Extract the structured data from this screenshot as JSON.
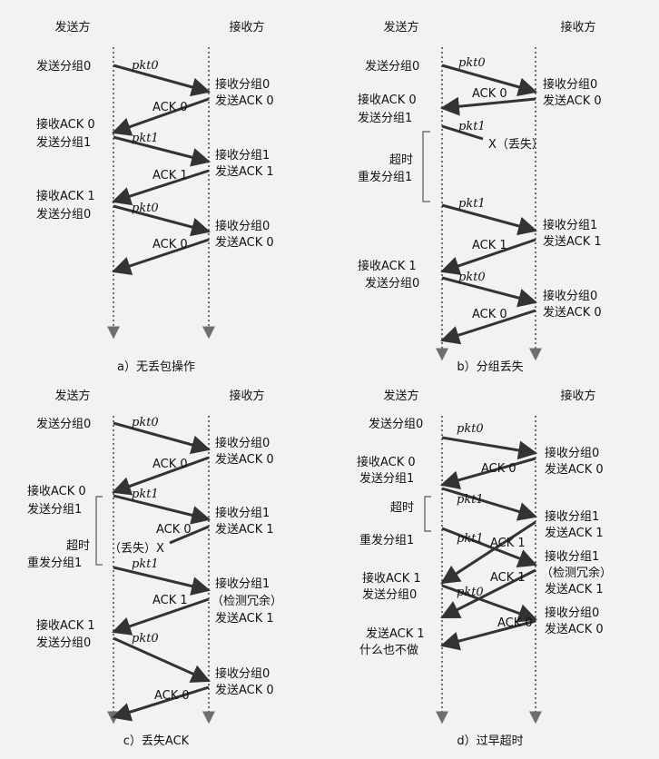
{
  "panels": [
    {
      "id": "a",
      "sender_header": "发送方",
      "receiver_header": "接收方",
      "caption": "a）无丢包操作",
      "sender_events": [
        "发送分组0",
        "接收ACK 0",
        "发送分组1",
        "接收ACK 1",
        "发送分组0"
      ],
      "receiver_events": [
        "接收分组0",
        "发送ACK 0",
        "接收分组1",
        "发送ACK 1",
        "接收分组0",
        "发送ACK 0"
      ],
      "arrow_labels": [
        "pkt0",
        "ACK 0",
        "pkt1",
        "ACK 1",
        "pkt0",
        "ACK 0"
      ]
    },
    {
      "id": "b",
      "sender_header": "发送方",
      "receiver_header": "接收方",
      "caption": "b）分组丢失",
      "sender_events": [
        "发送分组0",
        "接收ACK 0",
        "发送分组1",
        "超时",
        "重发分组1",
        "接收ACK 1",
        "发送分组0"
      ],
      "receiver_events": [
        "接收分组0",
        "发送ACK 0",
        "接收分组1",
        "发送ACK 1",
        "接收分组0",
        "发送ACK 0"
      ],
      "arrow_labels": [
        "pkt0",
        "ACK 0",
        "pkt1",
        "pkt1",
        "ACK 1",
        "pkt0",
        "ACK 0"
      ],
      "loss_label": "X（丢失）"
    },
    {
      "id": "c",
      "sender_header": "发送方",
      "receiver_header": "接收方",
      "caption": "c）丢失ACK",
      "sender_events": [
        "发送分组0",
        "接收ACK 0",
        "发送分组1",
        "超时",
        "重发分组1",
        "接收ACK 1",
        "发送分组0"
      ],
      "receiver_events": [
        "接收分组0",
        "发送ACK 0",
        "接收分组1",
        "发送ACK 1",
        "接收分组1",
        "（检测冗余）",
        "发送ACK 1",
        "接收分组0",
        "发送ACK 0"
      ],
      "arrow_labels": [
        "pkt0",
        "ACK 0",
        "pkt1",
        "ACK 0",
        "pkt1",
        "ACK 1",
        "pkt0",
        "ACK 0"
      ],
      "loss_label": "（丢失）X"
    },
    {
      "id": "d",
      "sender_header": "发送方",
      "receiver_header": "接收方",
      "caption": "d）过早超时",
      "sender_events": [
        "发送分组0",
        "接收ACK 0",
        "发送分组1",
        "超时",
        "重发分组1",
        "接收ACK 1",
        "发送分组0",
        "发送ACK 1",
        "什么也不做"
      ],
      "receiver_events": [
        "接收分组0",
        "发送ACK 0",
        "接收分组1",
        "发送ACK 1",
        "接收分组1",
        "（检测冗余）",
        "发送ACK 1",
        "接收分组0",
        "发送ACK 0"
      ],
      "arrow_labels": [
        "pkt0",
        "ACK 0",
        "pkt1",
        "pkt1",
        "ACK 1",
        "ACK 1",
        "pkt0",
        "ACK 0"
      ]
    }
  ],
  "colors": {
    "line": "#333333",
    "timeline": "#6e6e6e",
    "background": "#f1f2f3"
  }
}
